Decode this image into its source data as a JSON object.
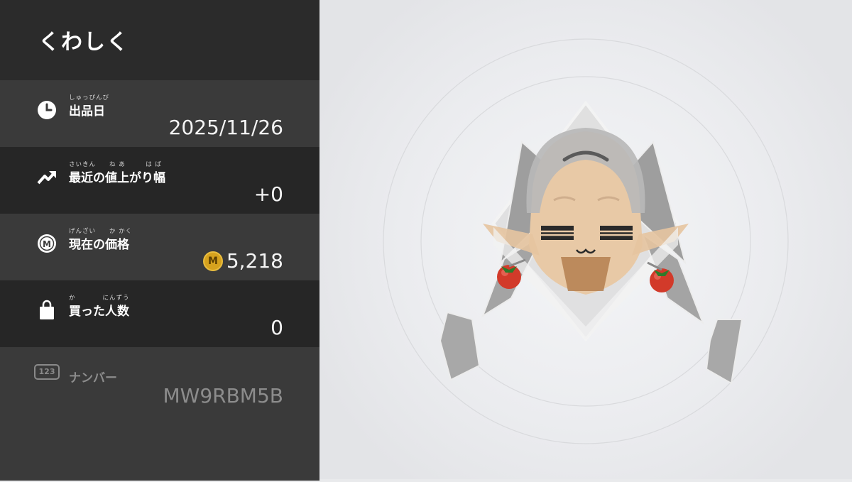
{
  "panel": {
    "title": "くわしく"
  },
  "rows": {
    "release_date": {
      "icon": "clock-icon",
      "ruby": "しゅっぴんび",
      "label": "出品日",
      "value": "2025/11/26"
    },
    "recent_increase": {
      "icon": "trending-up-icon",
      "ruby": "さいきん　　ね あ　　　は ば",
      "label": "最近の値上がり幅",
      "value": "+0"
    },
    "current_price": {
      "icon": "coin-m-icon",
      "ruby": "げんざい　　か かく",
      "label": "現在の価格",
      "coin_letter": "M",
      "value": "5,218"
    },
    "buyers": {
      "icon": "shopping-bag-icon",
      "ruby": "か　　　　にんずう",
      "label": "買った人数",
      "value": "0"
    },
    "number": {
      "icon": "number-123-icon",
      "badge": "123",
      "label": "ナンバー",
      "value": "MW9RBM5B"
    }
  },
  "colors": {
    "panel_bg": "#2b2b2b",
    "row_light": "#3a3a3a",
    "row_dark": "#262626",
    "coin": "#d6a21e",
    "stage_bg": "#e9eaec"
  }
}
